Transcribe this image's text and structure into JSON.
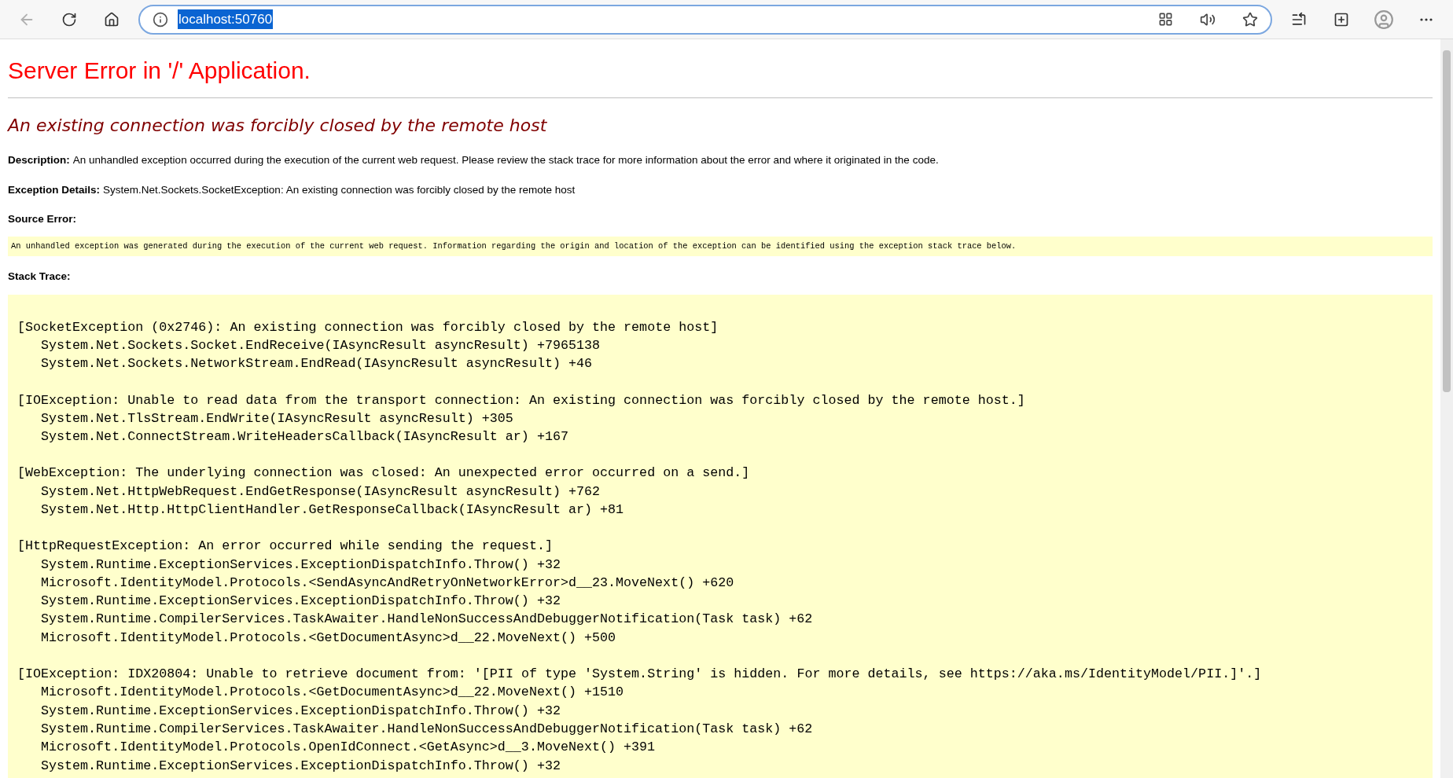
{
  "browser": {
    "address": {
      "value": "localhost:50760",
      "selected": true
    }
  },
  "page": {
    "title": "Server Error in '/' Application.",
    "heading": "An existing connection was forcibly closed by the remote host",
    "description": {
      "label": "Description:",
      "text": "An unhandled exception occurred during the execution of the current web request. Please review the stack trace for more information about the error and where it originated in the code."
    },
    "exception_details": {
      "label": "Exception Details:",
      "text": "System.Net.Sockets.SocketException: An existing connection was forcibly closed by the remote host"
    },
    "source_error": {
      "label": "Source Error:",
      "text": "An unhandled exception was generated during the execution of the current web request. Information regarding the origin and location of the exception can be identified using the exception stack trace below."
    },
    "stack_trace": {
      "label": "Stack Trace:",
      "groups": [
        {
          "exception": "[SocketException (0x2746): An existing connection was forcibly closed by the remote host]",
          "frames": [
            "System.Net.Sockets.Socket.EndReceive(IAsyncResult asyncResult) +7965138",
            "System.Net.Sockets.NetworkStream.EndRead(IAsyncResult asyncResult) +46"
          ]
        },
        {
          "exception": "[IOException: Unable to read data from the transport connection: An existing connection was forcibly closed by the remote host.]",
          "frames": [
            "System.Net.TlsStream.EndWrite(IAsyncResult asyncResult) +305",
            "System.Net.ConnectStream.WriteHeadersCallback(IAsyncResult ar) +167"
          ]
        },
        {
          "exception": "[WebException: The underlying connection was closed: An unexpected error occurred on a send.]",
          "frames": [
            "System.Net.HttpWebRequest.EndGetResponse(IAsyncResult asyncResult) +762",
            "System.Net.Http.HttpClientHandler.GetResponseCallback(IAsyncResult ar) +81"
          ]
        },
        {
          "exception": "[HttpRequestException: An error occurred while sending the request.]",
          "frames": [
            "System.Runtime.ExceptionServices.ExceptionDispatchInfo.Throw() +32",
            "Microsoft.IdentityModel.Protocols.<SendAsyncAndRetryOnNetworkError>d__23.MoveNext() +620",
            "System.Runtime.ExceptionServices.ExceptionDispatchInfo.Throw() +32",
            "System.Runtime.CompilerServices.TaskAwaiter.HandleNonSuccessAndDebuggerNotification(Task task) +62",
            "Microsoft.IdentityModel.Protocols.<GetDocumentAsync>d__22.MoveNext() +500"
          ]
        },
        {
          "exception": "[IOException: IDX20804: Unable to retrieve document from: '[PII of type 'System.String' is hidden. For more details, see https://aka.ms/IdentityModel/PII.]'.]",
          "frames": [
            "Microsoft.IdentityModel.Protocols.<GetDocumentAsync>d__22.MoveNext() +1510",
            "System.Runtime.ExceptionServices.ExceptionDispatchInfo.Throw() +32",
            "System.Runtime.CompilerServices.TaskAwaiter.HandleNonSuccessAndDebuggerNotification(Task task) +62",
            "Microsoft.IdentityModel.Protocols.OpenIdConnect.<GetAsync>d__3.MoveNext() +391",
            "System.Runtime.ExceptionServices.ExceptionDispatchInfo.Throw() +32"
          ]
        }
      ]
    }
  }
}
